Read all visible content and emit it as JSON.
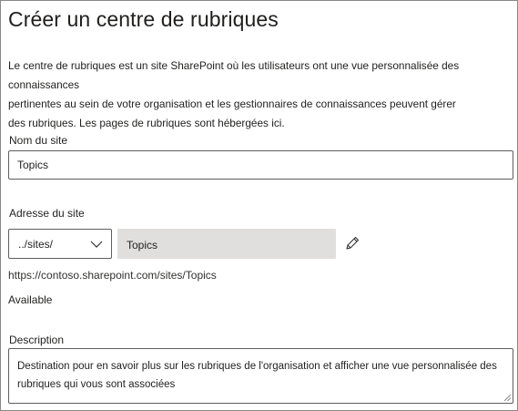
{
  "page": {
    "title": "Créer un centre de rubriques",
    "intro_lines": [
      "Le centre de rubriques est un site SharePoint où les utilisateurs ont une vue personnalisée des connaissances",
      "pertinentes au sein de votre organisation et les gestionnaires de connaissances peuvent gérer",
      "des rubriques. Les pages de rubriques sont hébergées ici."
    ]
  },
  "site_name": {
    "label": "Nom du site",
    "value": "Topics"
  },
  "site_address": {
    "label": "Adresse du site",
    "path_prefix": "../sites/",
    "value": "Topics",
    "edit_icon": "pencil-icon",
    "full_url": "https://contoso.sharepoint.com/sites/Topics",
    "status": "Available"
  },
  "description": {
    "label": "Description",
    "lines": [
      "Destination pour en savoir plus sur les rubriques de l'organisation et afficher une vue personnalisée des",
      "rubriques qui vous sont associées"
    ]
  },
  "colors": {
    "border": "#8a8886",
    "input_border": "#605e5c",
    "readonly_bg": "#e1dfdd",
    "text": "#201f1e"
  }
}
